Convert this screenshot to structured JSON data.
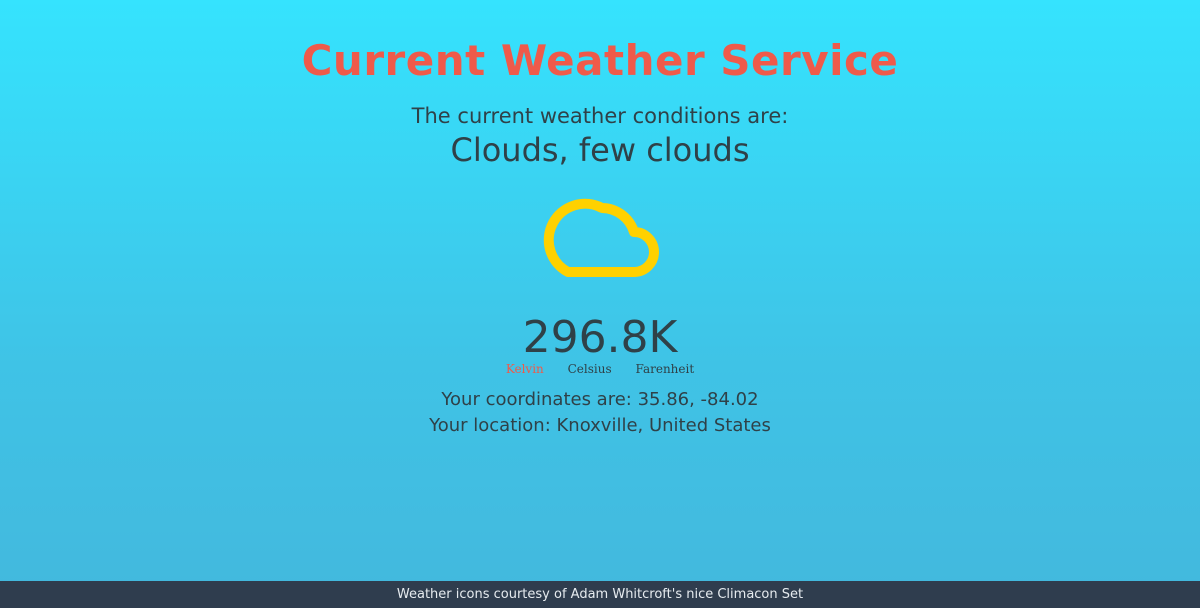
{
  "header": {
    "title": "Current Weather Service"
  },
  "conditions": {
    "label": "The current weather conditions are:",
    "value": "Clouds, few clouds",
    "icon": "cloud-icon",
    "icon_color": "#ffd100"
  },
  "temperature": {
    "value": "296.8K",
    "units": [
      {
        "label": "Kelvin",
        "active": true
      },
      {
        "label": "Celsius",
        "active": false
      },
      {
        "label": "Farenheit",
        "active": false
      }
    ]
  },
  "location": {
    "coords_text": "Your coordinates are: 35.86, -84.02",
    "location_text": "Your location: Knoxville, United States"
  },
  "footer": {
    "text": "Weather icons courtesy of Adam Whitcroft's nice Climacon Set"
  },
  "colors": {
    "accent": "#ef5a4a",
    "text": "#2f4148",
    "footer_bg": "#2f3d4e",
    "bg_top": "#35e3fe",
    "bg_bottom": "#43b8dd"
  }
}
